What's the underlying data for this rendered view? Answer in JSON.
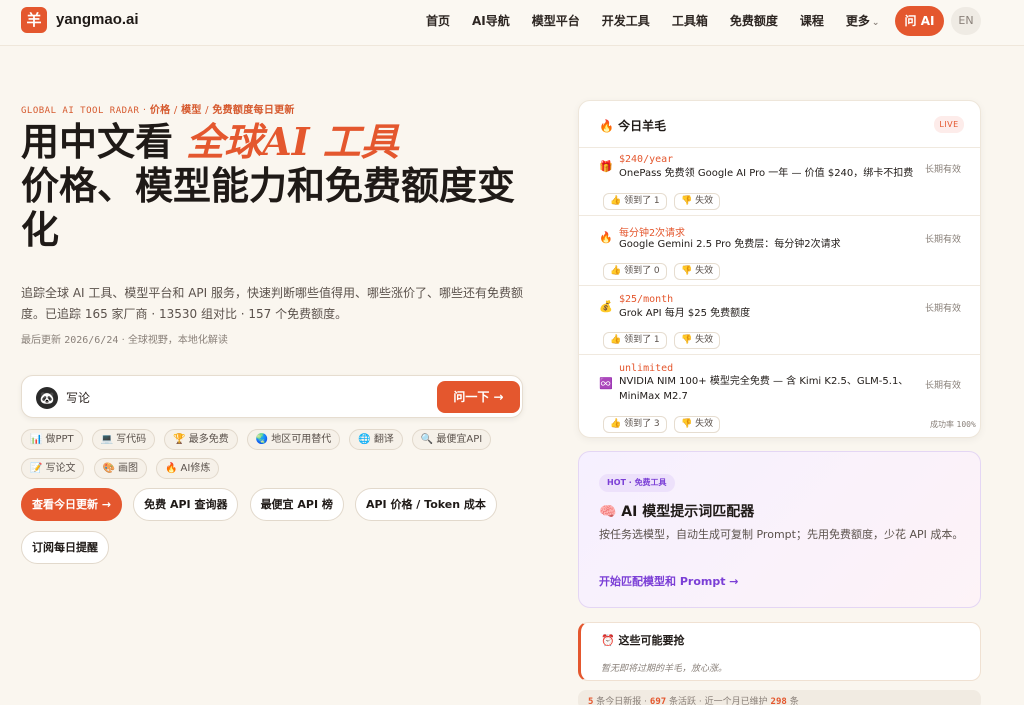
{
  "nav": {
    "logo_char": "羊",
    "brand": "yangmao.ai",
    "links": [
      "首页",
      "AI导航",
      "模型平台",
      "开发工具",
      "工具箱",
      "免费额度",
      "课程",
      "更多"
    ],
    "more_arrow": "⌄",
    "ask_label": "问 AI",
    "lang_label": "EN"
  },
  "hero": {
    "eyebrow_en": "GLOBAL AI TOOL RADAR",
    "eyebrow_sep": "·",
    "eyebrow_crumbs": [
      "价格",
      "模型",
      "免费额度每日更新"
    ],
    "eyebrow_slash": "/",
    "headline_plain": "用中文看",
    "headline_accent": "全球AI 工具",
    "headline_rest": "价格、模型能力和免费额度变化",
    "description": "追踪全球 AI 工具、模型平台和 API 服务，快速判断哪些值得用、哪些涨价了、哪些还有免费额度。已追踪 165 家厂商 · 13530 组对比 · 157 个免费额度。",
    "meta_label": "最后更新",
    "meta_date": "2026/6/24",
    "meta_sep": "·",
    "meta_tail": "全球视野，本地化解读"
  },
  "search": {
    "avatar": "🐼",
    "value": "写论",
    "placeholder": "",
    "button": "问一下 →"
  },
  "chips": [
    {
      "icon": "📊",
      "label": "做PPT"
    },
    {
      "icon": "💻",
      "label": "写代码"
    },
    {
      "icon": "🏆",
      "label": "最多免费"
    },
    {
      "icon": "🌏",
      "label": "地区可用替代"
    },
    {
      "icon": "🌐",
      "label": "翻译"
    },
    {
      "icon": "🔍",
      "label": "最便宜API"
    },
    {
      "icon": "📝",
      "label": "写论文"
    },
    {
      "icon": "🎨",
      "label": "画图"
    },
    {
      "icon": "🔥",
      "label": "AI修炼"
    }
  ],
  "ctas": [
    "查看今日更新 →",
    "免费 API 查询器",
    "最便宜 API 榜",
    "API 价格 / Token 成本",
    "订阅每日提醒"
  ],
  "today": {
    "title_icon": "🔥",
    "title": "今日羊毛",
    "live": "LIVE",
    "deals": [
      {
        "icon": "🎁",
        "price": "$240/year",
        "title": "OnePass 免费领 Google AI Pro 一年 — 价值 $240，绑卡不扣费",
        "valid": "长期有效",
        "got": "👍 领到了 1",
        "fail": "👎 失效"
      },
      {
        "icon": "🔥",
        "price": "每分钟2次请求",
        "title": "Google Gemini 2.5 Pro 免费层：每分钟2次请求",
        "valid": "长期有效",
        "got": "👍 领到了 0",
        "fail": "👎 失效"
      },
      {
        "icon": "💰",
        "price": "$25/month",
        "title": "Grok API 每月 $25 免费额度",
        "valid": "长期有效",
        "got": "👍 领到了 1",
        "fail": "👎 失效"
      },
      {
        "icon": "♾️",
        "price": "unlimited",
        "title": "NVIDIA NIM 100+ 模型完全免费 — 含 Kimi K2.5、GLM-5.1、MiniMax M2.7",
        "valid": "长期有效",
        "got": "👍 领到了 3",
        "fail": "👎 失效"
      }
    ],
    "success_label": "成功率",
    "success_value": "100%"
  },
  "hot": {
    "badge": "HOT · 免费工具",
    "title": "🧠 AI 模型提示词匹配器",
    "desc": "按任务选模型，自动生成可复制 Prompt；先用免费额度，少花 API 成本。",
    "link": "开始匹配模型和 Prompt →"
  },
  "urgent": {
    "title": "⏰ 这些可能要抢",
    "desc": "暂无即将过期的羊毛，放心涨。"
  },
  "stats": {
    "a_num": "5",
    "a_label": "条今日新报",
    "b_num": "697",
    "b_label": "条活跃",
    "c_label": "近一个月已维护",
    "c_num": "298",
    "c_tail": "条"
  }
}
